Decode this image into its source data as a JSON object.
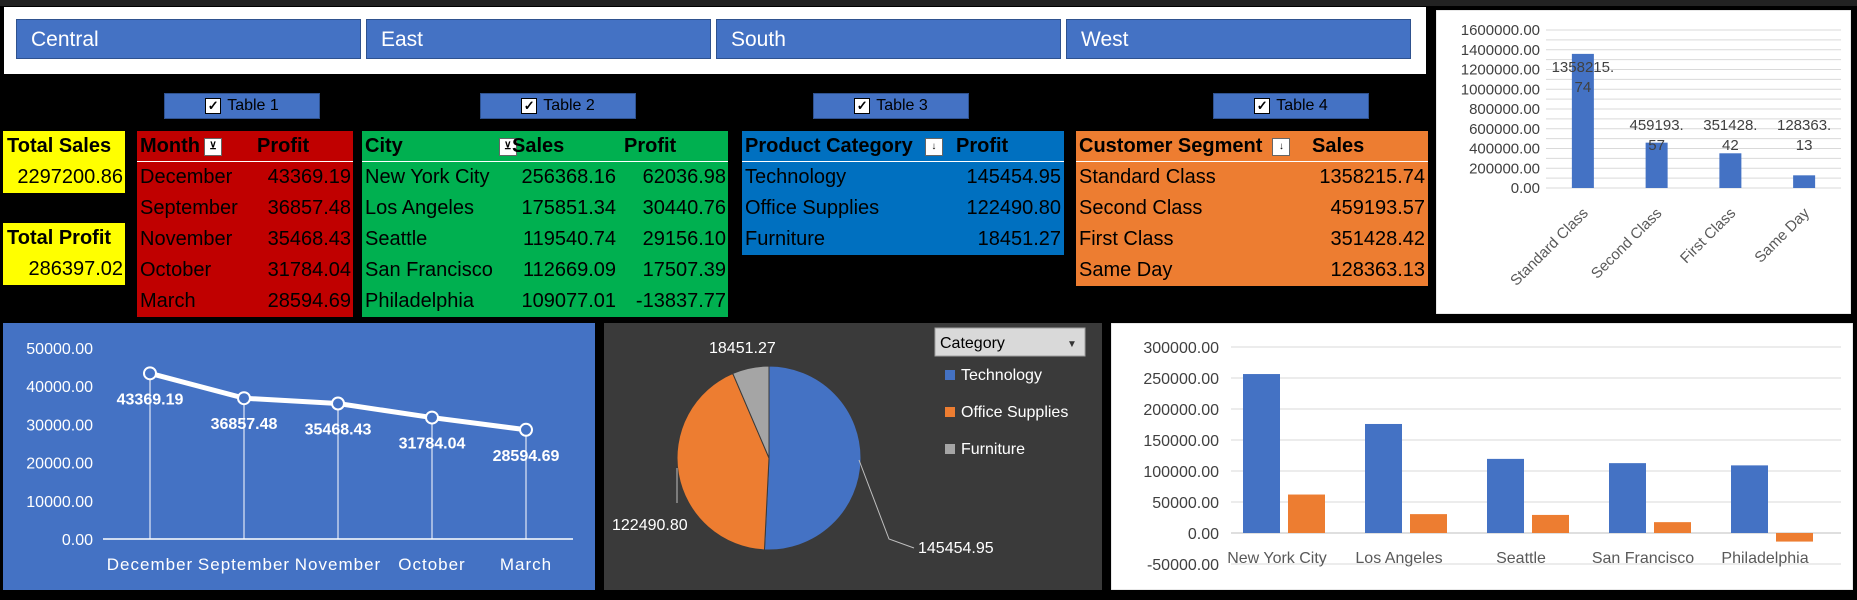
{
  "regions": [
    "Central",
    "East",
    "South",
    "West"
  ],
  "toggles": [
    "Table 1",
    "Table 2",
    "Table 3",
    "Table 4"
  ],
  "kpi": {
    "total_sales_label": "Total Sales",
    "total_sales": "2297200.86",
    "total_profit_label": "Total Profit",
    "total_profit": "286397.02"
  },
  "table1": {
    "headers": [
      "Month",
      "Profit"
    ],
    "rows": [
      [
        "December",
        "43369.19"
      ],
      [
        "September",
        "36857.48"
      ],
      [
        "November",
        "35468.43"
      ],
      [
        "October",
        "31784.04"
      ],
      [
        "March",
        "28594.69"
      ]
    ]
  },
  "table2": {
    "headers": [
      "City",
      "Sales",
      "Profit"
    ],
    "rows": [
      [
        "New York City",
        "256368.16",
        "62036.98"
      ],
      [
        "Los Angeles",
        "175851.34",
        "30440.76"
      ],
      [
        "Seattle",
        "119540.74",
        "29156.10"
      ],
      [
        "San Francisco",
        "112669.09",
        "17507.39"
      ],
      [
        "Philadelphia",
        "109077.01",
        "-13837.77"
      ]
    ]
  },
  "table3": {
    "headers": [
      "Product Category",
      "Profit"
    ],
    "rows": [
      [
        "Technology",
        "145454.95"
      ],
      [
        "Office Supplies",
        "122490.80"
      ],
      [
        "Furniture",
        "18451.27"
      ]
    ]
  },
  "table4": {
    "headers": [
      "Customer Segment",
      "Sales"
    ],
    "rows": [
      [
        "Standard Class",
        "1358215.74"
      ],
      [
        "Second Class",
        "459193.57"
      ],
      [
        "First Class",
        "351428.42"
      ],
      [
        "Same Day",
        "128363.13"
      ]
    ]
  },
  "chart_data": [
    {
      "type": "bar",
      "categories": [
        "Standard Class",
        "Second Class",
        "First Class",
        "Same Day"
      ],
      "values": [
        1358215.74,
        459193.57,
        351428.42,
        128363.13
      ],
      "data_labels": [
        "1358215.74",
        "459193.57",
        "351428.42",
        "128363.13"
      ],
      "ylim": [
        0,
        1600000
      ],
      "yticks": [
        "0.00",
        "200000.00",
        "400000.00",
        "600000.00",
        "800000.00",
        "1000000.00",
        "1200000.00",
        "1400000.00",
        "1600000.00"
      ],
      "grid": true,
      "colors": {
        "bar": "#4472c4",
        "bg": "#ffffff"
      }
    },
    {
      "type": "line",
      "categories": [
        "December",
        "September",
        "November",
        "October",
        "March"
      ],
      "values": [
        43369.19,
        36857.48,
        35468.43,
        31784.04,
        28594.69
      ],
      "data_labels": [
        "43369.19",
        "36857.48",
        "35468.43",
        "31784.04",
        "28594.69"
      ],
      "ylim": [
        0,
        50000
      ],
      "yticks": [
        "0.00",
        "10000.00",
        "20000.00",
        "30000.00",
        "40000.00",
        "50000.00"
      ],
      "colors": {
        "bg": "#4472c4",
        "line": "#ffffff"
      }
    },
    {
      "type": "pie",
      "categories": [
        "Technology",
        "Office Supplies",
        "Furniture"
      ],
      "values": [
        145454.95,
        122490.8,
        18451.27
      ],
      "data_labels": [
        "145454.95",
        "122490.80",
        "18451.27"
      ],
      "filter_label": "Category",
      "legend": "right",
      "colors": {
        "Technology": "#4472c4",
        "Office Supplies": "#ed7d31",
        "Furniture": "#a5a5a5",
        "bg": "#3a3a3a"
      }
    },
    {
      "type": "bar",
      "categories": [
        "New York City",
        "Los Angeles",
        "Seattle",
        "San Francisco",
        "Philadelphia"
      ],
      "series": [
        {
          "values": [
            256368.16,
            175851.34,
            119540.74,
            112669.09,
            109077.01
          ]
        },
        {
          "values": [
            62036.98,
            30440.76,
            29156.1,
            17507.39,
            -13837.77
          ]
        }
      ],
      "ylim": [
        -50000,
        300000
      ],
      "yticks": [
        "-50000.00",
        "0.00",
        "50000.00",
        "100000.00",
        "150000.00",
        "200000.00",
        "250000.00",
        "300000.00"
      ],
      "grid": true,
      "colors": {
        "s1": "#4472c4",
        "s2": "#ed7d31",
        "bg": "#ffffff"
      }
    }
  ]
}
